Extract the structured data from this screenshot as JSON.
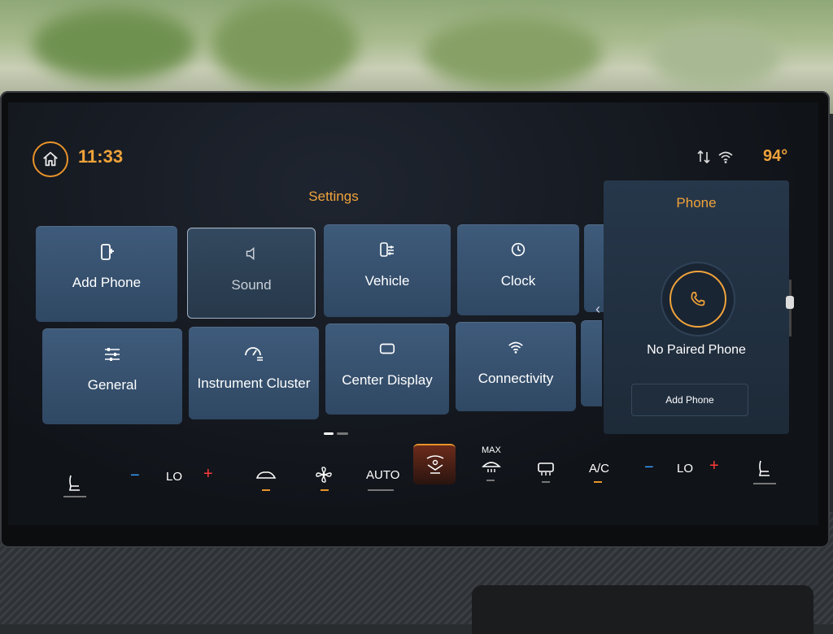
{
  "status": {
    "time": "11:33",
    "temperature": "94°"
  },
  "settings": {
    "title": "Settings",
    "tiles_row1": [
      {
        "label": "Add Phone",
        "icon": "add-phone-icon"
      },
      {
        "label": "Sound",
        "icon": "speaker-icon",
        "selected": true
      },
      {
        "label": "Vehicle",
        "icon": "vehicle-settings-icon"
      },
      {
        "label": "Clock",
        "icon": "clock-icon"
      }
    ],
    "tiles_row2": [
      {
        "label": "General",
        "icon": "sliders-icon"
      },
      {
        "label": "Instrument Cluster",
        "icon": "gauge-icon"
      },
      {
        "label": "Center Display",
        "icon": "display-icon"
      },
      {
        "label": "Connectivity",
        "icon": "wifi-icon"
      }
    ]
  },
  "phone": {
    "title": "Phone",
    "status": "No Paired Phone",
    "button": "Add Phone"
  },
  "climate": {
    "left_temp": "LO",
    "right_temp": "LO",
    "auto": "AUTO",
    "max": "MAX",
    "ac": "A/C",
    "minus": "−",
    "plus": "+"
  },
  "colors": {
    "accent": "#f0a33a",
    "tile": "#3f5b7b",
    "minus": "#3aa0ff",
    "plus": "#ff3b3b"
  }
}
